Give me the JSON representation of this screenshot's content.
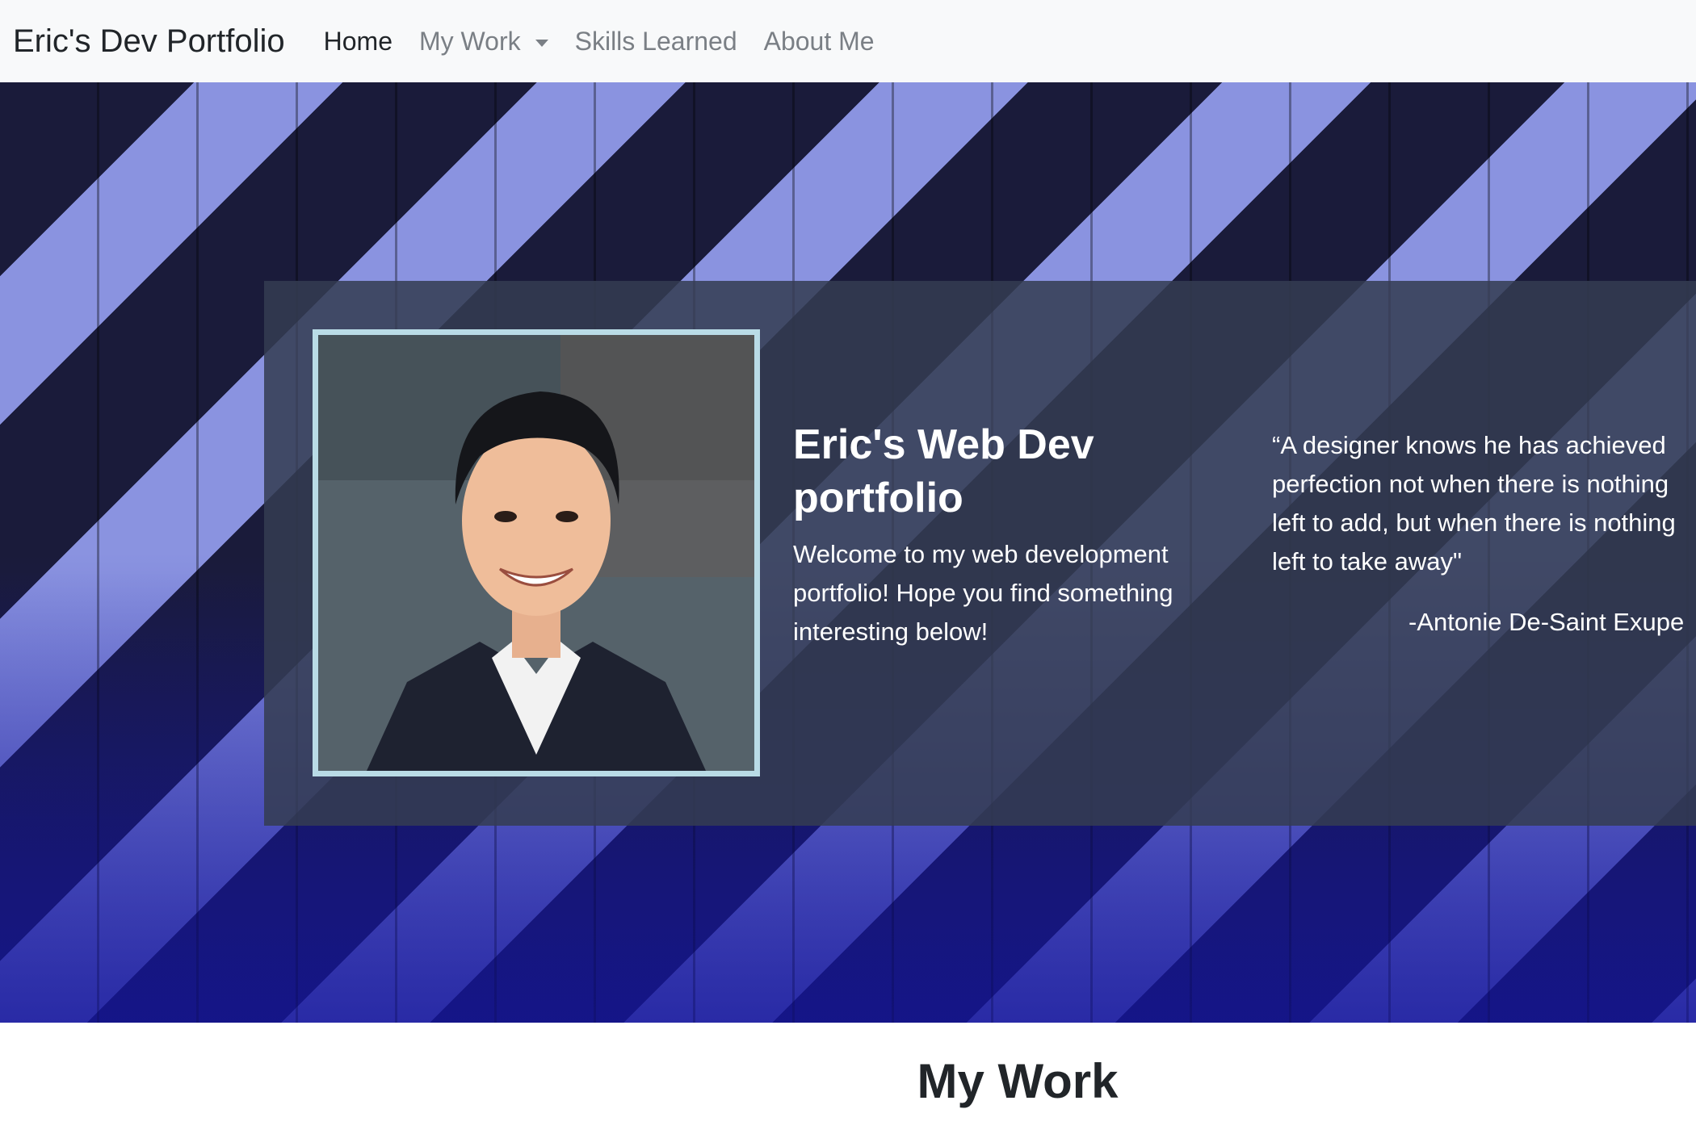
{
  "navbar": {
    "brand": "Eric's Dev Portfolio",
    "links": [
      {
        "label": "Home",
        "active": true
      },
      {
        "label": "My Work",
        "dropdown": true
      },
      {
        "label": "Skills Learned"
      },
      {
        "label": "About Me"
      }
    ]
  },
  "hero": {
    "title": "Eric's Web Dev portfolio",
    "text": "Welcome to my web development portfolio! Hope you find something interesting below!",
    "quote": "“A designer knows he has achieved perfection not when there is nothing left to add, but when there is nothing left to take away\"",
    "quote_author": "-Antonie De-Saint Exupe",
    "photo_alt": "portrait-photo"
  },
  "sections": {
    "my_work_title": "My Work"
  },
  "colors": {
    "navbar_bg": "#f8f9fa",
    "panel_bg": "#343d52",
    "photo_border": "#b9dbe6",
    "stripe_dark": "#1a1b3a",
    "stripe_light": "#8a93e0"
  }
}
